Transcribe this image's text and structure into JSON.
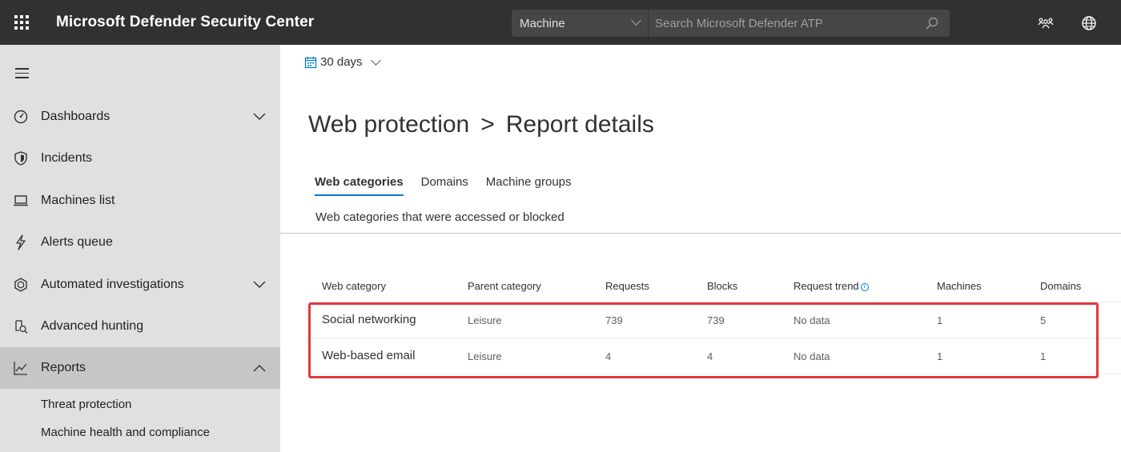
{
  "header": {
    "app_title": "Microsoft Defender Security Center",
    "scope_selected": "Machine",
    "search_placeholder": "Search Microsoft Defender ATP"
  },
  "sidebar": {
    "items": [
      {
        "label": "Dashboards",
        "icon": "dashboard-gauge-icon",
        "expandable": true,
        "expanded": false
      },
      {
        "label": "Incidents",
        "icon": "shield-icon",
        "expandable": false
      },
      {
        "label": "Machines list",
        "icon": "laptop-icon",
        "expandable": false
      },
      {
        "label": "Alerts queue",
        "icon": "lightning-icon",
        "expandable": false
      },
      {
        "label": "Automated investigations",
        "icon": "hexagon-icon",
        "expandable": true,
        "expanded": false
      },
      {
        "label": "Advanced hunting",
        "icon": "hunting-icon",
        "expandable": false
      },
      {
        "label": "Reports",
        "icon": "line-chart-icon",
        "expandable": true,
        "expanded": true,
        "active": true
      }
    ],
    "sub_items": [
      "Threat protection",
      "Machine health and compliance"
    ]
  },
  "main": {
    "date_filter": "30 days",
    "breadcrumb": {
      "parent": "Web protection",
      "separator": ">",
      "current": "Report details"
    },
    "tabs": [
      {
        "label": "Web categories",
        "active": true
      },
      {
        "label": "Domains",
        "active": false
      },
      {
        "label": "Machine groups",
        "active": false
      }
    ],
    "tab_description": "Web categories that were accessed or blocked",
    "table": {
      "columns": [
        "Web category",
        "Parent category",
        "Requests",
        "Blocks",
        "Request trend",
        "Machines",
        "Domains"
      ],
      "rows": [
        [
          "Social networking",
          "Leisure",
          "739",
          "739",
          "No data",
          "1",
          "5"
        ],
        [
          "Web-based email",
          "Leisure",
          "4",
          "4",
          "No data",
          "1",
          "1"
        ]
      ]
    }
  },
  "colors": {
    "topbar": "#323130",
    "sidebar": "#e1e0df",
    "sidebar_active": "#c8c6c4",
    "accent": "#0078d4",
    "highlight": "#e0393e"
  }
}
